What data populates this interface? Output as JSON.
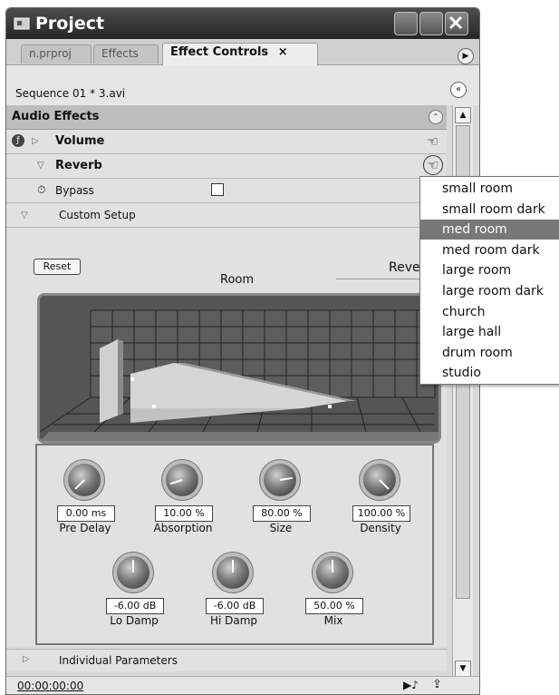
{
  "window": {
    "title": "Project"
  },
  "tabs": [
    {
      "label": "n.prproj"
    },
    {
      "label": "Effects"
    },
    {
      "label": "Effect Controls",
      "close": "×"
    }
  ],
  "sequence": {
    "label": "Sequence 01 * 3.avi"
  },
  "audio_effects": {
    "header": "Audio Effects",
    "volume": {
      "label": "Volume"
    },
    "reverb": {
      "label": "Reverb",
      "bypass_label": "Bypass",
      "custom_setup_label": "Custom Setup"
    }
  },
  "custom_setup": {
    "reset_label": "Reset",
    "room_label": "Room",
    "preset_text": "Reve"
  },
  "knobs": [
    {
      "value": "0.00 ms",
      "label": "Pre Delay",
      "level": 0.0
    },
    {
      "value": "10.00 %",
      "label": "Absorption",
      "level": 0.1
    },
    {
      "value": "80.00 %",
      "label": "Size",
      "level": 0.8
    },
    {
      "value": "100.00 %",
      "label": "Density",
      "level": 1.0
    },
    {
      "value": "-6.00 dB",
      "label": "Lo Damp",
      "level": 0.5
    },
    {
      "value": "-6.00 dB",
      "label": "Hi Damp",
      "level": 0.5
    },
    {
      "value": "50.00 %",
      "label": "Mix",
      "level": 0.5
    }
  ],
  "individual_parameters": {
    "label": "Individual Parameters"
  },
  "status": {
    "timecode": "00:00:00:00"
  },
  "dropdown": {
    "options": [
      "small room",
      "small room dark",
      "med room",
      "med room dark",
      "large room",
      "large room dark",
      "church",
      "large hall",
      "drum room",
      "studio"
    ],
    "selected": "med room"
  },
  "colors": {
    "titlebar": "#333333",
    "selection": "#777777",
    "panel": "#e1e1e1"
  }
}
